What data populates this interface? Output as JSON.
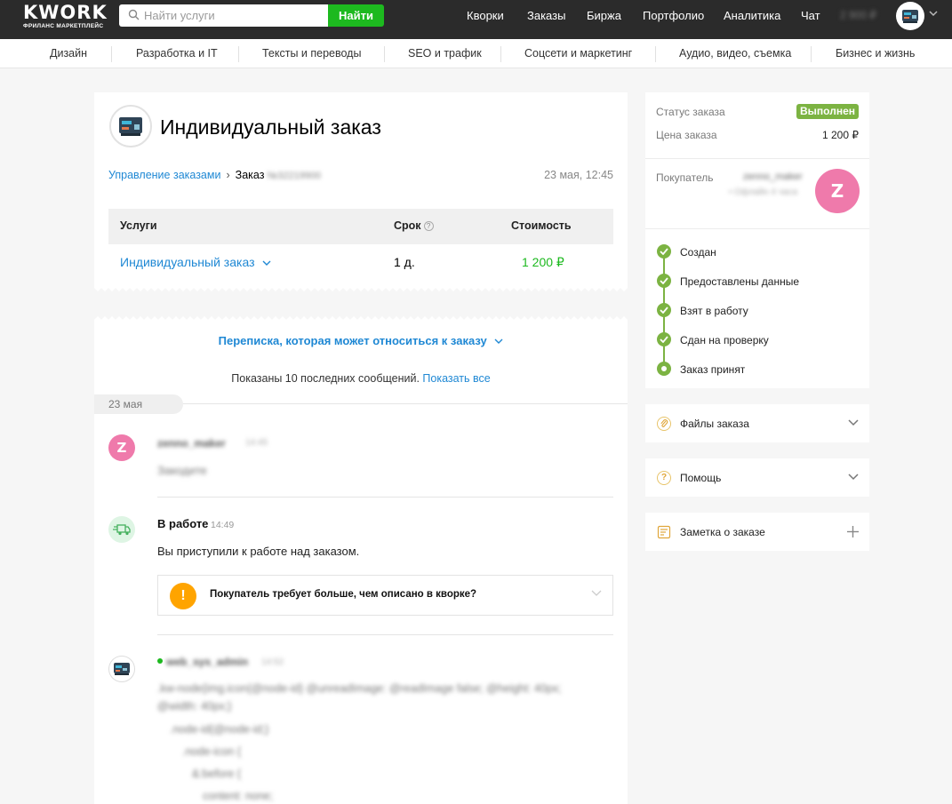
{
  "header": {
    "logo_text": "KWORK",
    "logo_tagline": "ФРИЛАНС МАРКЕТПЛЕЙС",
    "search_placeholder": "Найти услуги",
    "search_button": "Найти",
    "nav": [
      "Кворки",
      "Заказы",
      "Биржа",
      "Портфолио",
      "Аналитика",
      "Чат"
    ],
    "balance": "2 900 ₽"
  },
  "categories": [
    "Дизайн",
    "Разработка и IT",
    "Тексты и переводы",
    "SEO и трафик",
    "Соцсети и маркетинг",
    "Аудио, видео, съемка",
    "Бизнес и жизнь"
  ],
  "order": {
    "title": "Индивидуальный заказ",
    "breadcrumb_link": "Управление заказами",
    "breadcrumb_current": "Заказ",
    "order_number": "№32219900",
    "date": "23 мая, 12:45",
    "table": {
      "headers": [
        "Услуги",
        "Срок",
        "Стоимость"
      ],
      "row": {
        "service": "Индивидуальный заказ",
        "term": "1 д.",
        "price": "1 200 ₽"
      }
    }
  },
  "chat": {
    "correspondence_link": "Переписка, которая может относиться к заказу",
    "shown_text": "Показаны 10 последних сообщений.",
    "show_all": "Показать все",
    "day": "23 мая",
    "msg1": {
      "avatar_letter": "Z",
      "author": "zenno_maker",
      "time": "14:45",
      "text": "Закодите"
    },
    "status_msg": {
      "title": "В работе",
      "time": "14:49",
      "text": "Вы приступили к работе над заказом.",
      "alert": "Покупатель требует больше, чем описано в кворке?"
    },
    "msg3": {
      "author": "web_sys_admin",
      "time": "14:52",
      "lines": [
        ".kw-node{img.icon{@node-id} @unreadImage: @readImage false; @height: 40px;",
        "@width: 40px;}",
        ".node-id{@node-id;}",
        ".node-icon {",
        "&:before {",
        "content: none;"
      ]
    }
  },
  "sidebar": {
    "status_label": "Статус заказа",
    "status_value": "Выполнен",
    "price_label": "Цена заказа",
    "price_value": "1 200 ₽",
    "buyer_label": "Покупатель",
    "buyer_name": "zenno_maker",
    "buyer_online": "• Офлайн 4 часа",
    "buyer_letter": "Z",
    "steps": [
      "Создан",
      "Предоставлены данные",
      "Взят в работу",
      "Сдан на проверку",
      "Заказ принят"
    ],
    "files": "Файлы заказа",
    "help": "Помощь",
    "note": "Заметка о заказе"
  },
  "colors": {
    "accent_green": "#1db91f",
    "link_blue": "#1f88d4",
    "status_green": "#7cb342",
    "avatar_pink": "#ef7aab",
    "alert_orange": "#ffa400",
    "topbar": "#2b2b2b"
  }
}
